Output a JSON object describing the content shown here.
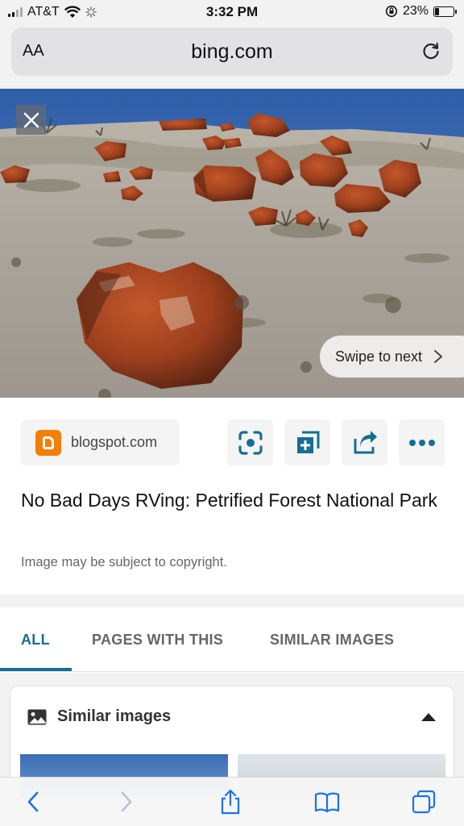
{
  "status_bar": {
    "carrier": "AT&T",
    "time": "3:32 PM",
    "battery": "23%",
    "battery_level": 0.23,
    "icons": [
      "signal-icon",
      "wifi-icon",
      "activity-spinner-icon",
      "orientation-lock-icon",
      "battery-icon"
    ]
  },
  "address_bar": {
    "text_size_label": "AA",
    "url": "bing.com",
    "reload_icon": "reload-icon"
  },
  "hero": {
    "close_icon": "close-icon",
    "swipe_label": "Swipe to next",
    "swipe_icon": "chevron-right-icon"
  },
  "source": {
    "icon": "blogger-icon",
    "domain": "blogspot.com"
  },
  "actions": [
    {
      "icon": "visual-search-icon"
    },
    {
      "icon": "add-to-collection-icon"
    },
    {
      "icon": "share-icon"
    },
    {
      "icon": "more-icon"
    }
  ],
  "result": {
    "title": "No Bad Days RVing: Petrified Forest National Park",
    "copyright": "Image may be subject to copyright."
  },
  "tabs": [
    {
      "label": "ALL",
      "active": true
    },
    {
      "label": "PAGES WITH THIS",
      "active": false
    },
    {
      "label": "SIMILAR IMAGES",
      "active": false
    }
  ],
  "similar": {
    "header": "Similar images",
    "icon": "image-icon",
    "toggle_icon": "collapse-caret-icon"
  },
  "toolbar": {
    "items": [
      "back-icon",
      "forward-icon",
      "share-icon",
      "bookmarks-icon",
      "tabs-icon"
    ]
  },
  "colors": {
    "accent": "#176e93",
    "blogger": "#f57d00"
  }
}
